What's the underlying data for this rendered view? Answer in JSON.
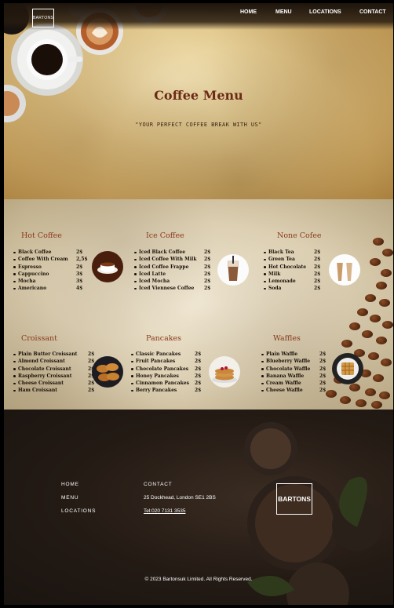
{
  "header": {
    "logo": "BARTONS",
    "nav": [
      "HOME",
      "MENU",
      "LOCATIONS",
      "CONTACT"
    ]
  },
  "hero": {
    "title": "Coffee Menu",
    "subtitle": "\"YOUR PERFECT COFFEE BREAK WITH US\""
  },
  "menu": {
    "sections": [
      {
        "title": "Hot Coffee",
        "items": [
          {
            "name": "Black Coffee",
            "price": "2$"
          },
          {
            "name": "Coffee With Cream",
            "price": "2,5$"
          },
          {
            "name": "Espresso",
            "price": "2$"
          },
          {
            "name": "Cappuccino",
            "price": "3$"
          },
          {
            "name": "Mocha",
            "price": "3$"
          },
          {
            "name": "Americano",
            "price": "4$"
          }
        ]
      },
      {
        "title": "Ice Coffee",
        "items": [
          {
            "name": "Iced Black Coffee",
            "price": "2$"
          },
          {
            "name": "Iced Coffee With Milk",
            "price": "2$"
          },
          {
            "name": "Iced Coffee Frappe",
            "price": "2$"
          },
          {
            "name": "Iced Latte",
            "price": "2$"
          },
          {
            "name": "Iced Mocha",
            "price": "2$"
          },
          {
            "name": "Iced Viennese Coffee",
            "price": "2$"
          }
        ]
      },
      {
        "title": "None Cofee",
        "items": [
          {
            "name": "Black Tea",
            "price": "2$"
          },
          {
            "name": "Green Tea",
            "price": "2$"
          },
          {
            "name": "Hot Chocolate",
            "price": "2$"
          },
          {
            "name": "Milk",
            "price": "2$"
          },
          {
            "name": "Lemonade",
            "price": "2$"
          },
          {
            "name": "Soda",
            "price": "2$"
          }
        ]
      },
      {
        "title": "Croissant",
        "items": [
          {
            "name": "Plain Butter Croissant",
            "price": "2$"
          },
          {
            "name": "Almond Croissant",
            "price": "2$"
          },
          {
            "name": "Chocolate Croissant",
            "price": "2$"
          },
          {
            "name": "Raspberry Croissant",
            "price": "2$"
          },
          {
            "name": "Cheese Croissant",
            "price": "2$"
          },
          {
            "name": "Ham Croissant",
            "price": "2$"
          }
        ]
      },
      {
        "title": "Pancakes",
        "items": [
          {
            "name": "Classic Pancakes",
            "price": "2$"
          },
          {
            "name": "Fruit Pancakes",
            "price": "2$"
          },
          {
            "name": "Chocolate Pancakes",
            "price": "2$"
          },
          {
            "name": "Honey Pancakes",
            "price": "2$"
          },
          {
            "name": "Cinnamon Pancakes",
            "price": "2$"
          },
          {
            "name": "Berry Pancakes",
            "price": "2$"
          }
        ]
      },
      {
        "title": "Waffles",
        "items": [
          {
            "name": "Plain Waffle",
            "price": "2$"
          },
          {
            "name": "Blueberry Waffle",
            "price": "2$"
          },
          {
            "name": "Chocolate Waffle",
            "price": "2$"
          },
          {
            "name": "Banana Waffle",
            "price": "2$"
          },
          {
            "name": "Cream Waffle",
            "price": "2$"
          },
          {
            "name": "Cheese Waffle",
            "price": "2$"
          }
        ]
      }
    ]
  },
  "footer": {
    "links": [
      "HOME",
      "MENU",
      "LOCATIONS"
    ],
    "contact_heading": "CONTACT",
    "address": "25 Dockhead, London SE1 2BS",
    "phone": "Tel:020 7131 3535",
    "logo": "BARTONS",
    "copyright": "© 2023 Bartonsuk Limited. All Rights Reserved."
  }
}
